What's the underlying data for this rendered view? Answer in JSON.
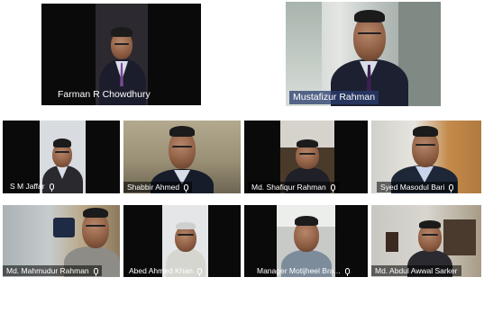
{
  "participants": [
    {
      "name": "Farman R Chowdhury",
      "mic": false
    },
    {
      "name": "Mustafizur Rahman",
      "mic": false,
      "active": true
    },
    {
      "name": "S M Jaffar",
      "mic": true
    },
    {
      "name": "Shabbir Ahmed",
      "mic": true
    },
    {
      "name": "Md. Shafiqur Rahman",
      "mic": true
    },
    {
      "name": "Syed Masodul Bari",
      "mic": true
    },
    {
      "name": "Md. Mahmudur Rahman",
      "mic": true
    },
    {
      "name": "Abed Ahmed Khan",
      "mic": true
    },
    {
      "name": "Manager Motijheel Bra...",
      "mic": true
    },
    {
      "name": "Md. Abdul Awwal Sarker",
      "mic": false
    }
  ],
  "icons": {
    "mic": "microphone-icon"
  },
  "colors": {
    "active_label_bg": "#283c6e",
    "tile_bg": "#0a0a0a"
  }
}
